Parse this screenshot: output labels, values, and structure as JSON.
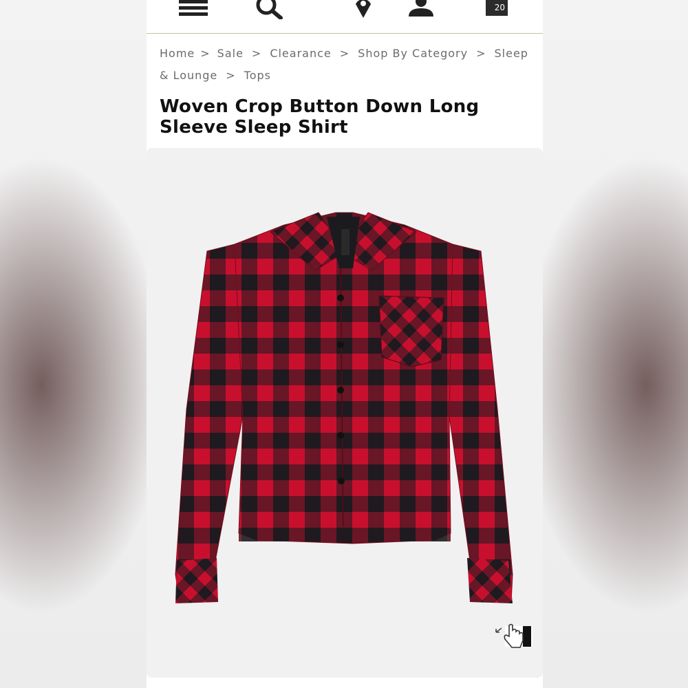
{
  "header": {
    "cart_count": "20",
    "icons": [
      "menu-icon",
      "search-icon",
      "location-pin-icon",
      "account-icon",
      "cart-bag-icon"
    ]
  },
  "breadcrumb": {
    "items": [
      "Home",
      "Sale",
      "Clearance",
      "Shop By Category",
      "Sleep & Lounge",
      "Tops"
    ],
    "separator": ">"
  },
  "product": {
    "title": "Woven Crop Button Down Long Sleeve Sleep Shirt",
    "image_alt": "Red and black buffalo plaid cropped button down shirt",
    "colors": {
      "red": "#c8102e",
      "black": "#1b1b1f"
    }
  },
  "zoom": {
    "icon": "tap-zoom-icon"
  }
}
